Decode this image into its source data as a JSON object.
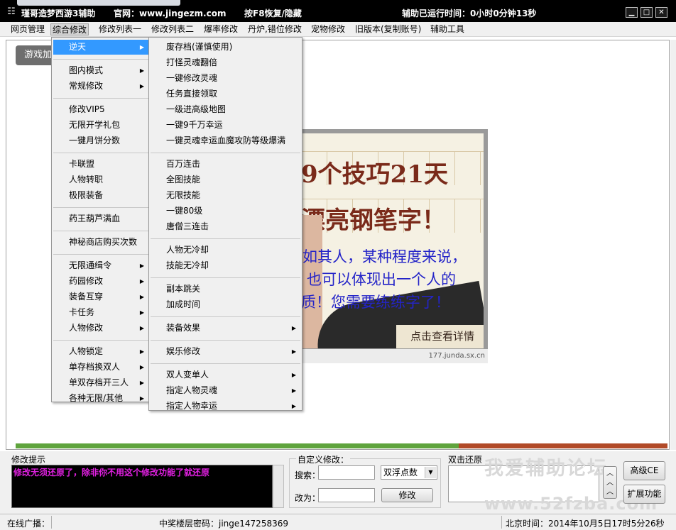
{
  "titlebar": {
    "app_title": "瑾哥造梦西游3辅助",
    "website": "官网：www.jingezm.com",
    "hotkey": "按F8恢复/隐藏",
    "runtime": "辅助已运行时间：0小时0分钟13秒",
    "minimize": "▁",
    "maximize": "□",
    "close": "✕"
  },
  "menubar": {
    "items": [
      "网页管理",
      "综合修改",
      "修改列表一",
      "修改列表二",
      "爆率修改",
      "丹炉,错位修改",
      "宠物修改",
      "旧版本(复制账号)",
      "辅助工具"
    ],
    "active": "综合修改"
  },
  "content": {
    "game_button": "游戏加",
    "progress_percent": 68
  },
  "ad": {
    "line1": "9个技巧21天",
    "line2": "漂亮钢笔字！",
    "line3": "如其人，某种程度来说，",
    "line4": "也可以体现出一个人的",
    "line5": "质！您需要练练字了！",
    "detail_button": "点击查看详情",
    "caption": "177.junda.sx.cn"
  },
  "menu1": {
    "groups": [
      [
        "逆天"
      ],
      [
        "图内模式",
        "常规修改"
      ],
      [
        "修改VIP5",
        "无限开学礼包",
        "一键月饼分数"
      ],
      [
        "卡联盟",
        "人物转职",
        "极限装备"
      ],
      [
        "药王葫芦满血"
      ],
      [
        "神秘商店购买次数"
      ],
      [
        "无限通缉令",
        "药园修改",
        "装备互穿",
        "卡任务",
        "人物修改"
      ],
      [
        "人物锁定",
        "单存档换双人",
        "单双存档开三人",
        "各种无限/其他"
      ]
    ],
    "highlighted": "逆天"
  },
  "menu2": {
    "groups": [
      [
        "废存档(谨慎使用)",
        "打怪灵魂翻倍",
        "一键修改灵魂",
        "任务直接领取",
        "一级进高级地图",
        "一键9千万幸运",
        "一键灵魂幸运血魔攻防等级爆满"
      ],
      [
        "百万连击",
        "全图技能",
        "无限技能",
        "一键80级",
        "唐僧三连击"
      ],
      [
        "人物无冷却",
        "技能无冷却"
      ],
      [
        "副本跳关",
        "加成时间"
      ],
      [
        "装备效果"
      ],
      [
        "娱乐修改"
      ],
      [
        "双人变单人",
        "指定人物灵魂",
        "指定人物幸运"
      ]
    ]
  },
  "bottom": {
    "hint_title": "修改提示",
    "hint_text": "修改无须还原了，除非你不用这个修改功能了就还原",
    "custom_title": "自定义修改：",
    "search_label": "搜索：",
    "search_value": "",
    "type_value": "双浮点数",
    "change_label": "改为：",
    "change_value": "",
    "modify_button": "修改",
    "restore_title": "双击还原",
    "advanced_ce": "高级CE",
    "extend_func": "扩展功能",
    "watermark_cn": "我爱辅助论坛",
    "watermark_url": "www.52fzba.com"
  },
  "statusbar": {
    "broadcast": "在线广播：",
    "password": "中奖楼层密码：jinge147258369",
    "time": "北京时间：2014年10月5日17时5分26秒"
  },
  "colors": {
    "hint_text": "#e020e0",
    "progress_fill": "#5fa43d",
    "progress_rest": "#b14a28",
    "highlight": "#3399ff"
  }
}
